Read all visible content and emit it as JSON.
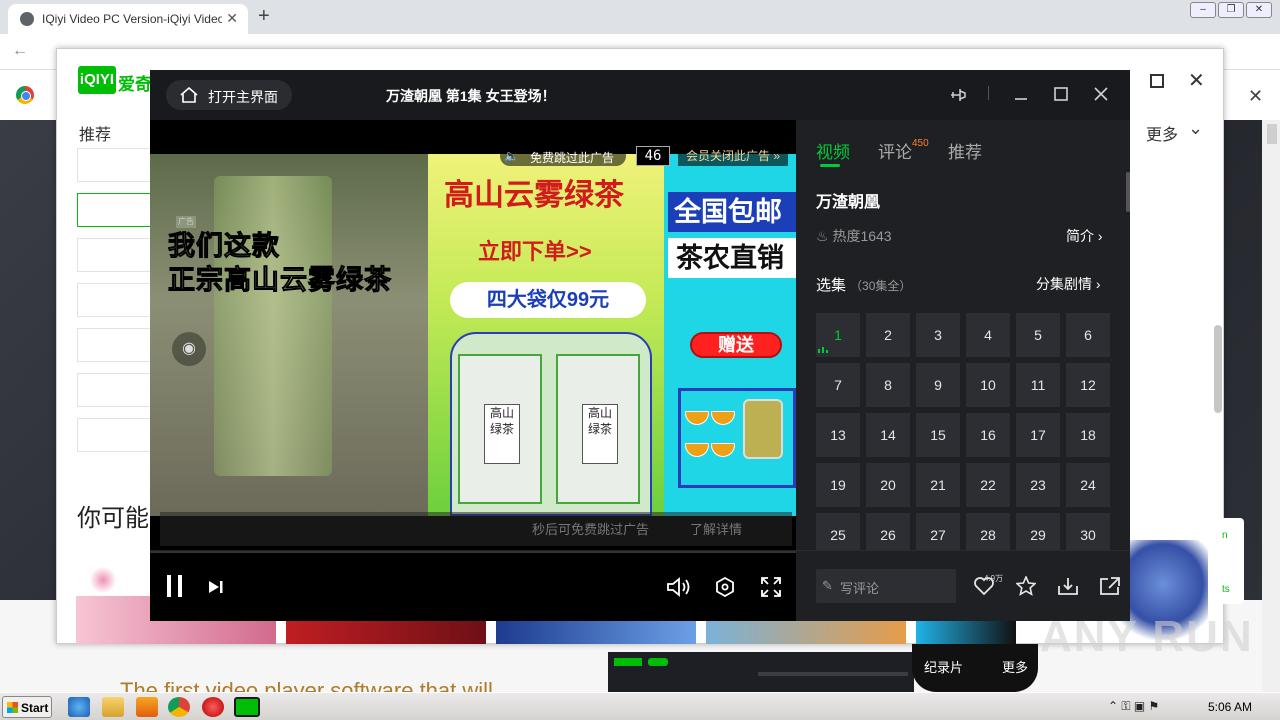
{
  "browser": {
    "tab_title": "IQiyi Video PC Version-iQiyi Video Of",
    "tab_close": "✕",
    "new_tab": "+",
    "window_buttons": [
      "–",
      "❐",
      "✕"
    ],
    "back_icon": "←",
    "infobar_close": "✕"
  },
  "background_site": {
    "logo_badge": "iQIYI",
    "logo_text": "爱奇",
    "recommend": "推荐",
    "maybe_like": "你可能",
    "more": "更多",
    "tagline": "The first video player software that will",
    "categories": [
      "纪录片",
      "更多"
    ],
    "card_text_1": "n",
    "card_text_2": "ts"
  },
  "player": {
    "home_button": "打开主界面",
    "video_title": "万渣朝凰 第1集 女王登场！",
    "ad": {
      "skip_label": "免费跳过此广告",
      "countdown": "46",
      "vip_close": "会员关闭此广告 »",
      "tag": "广告",
      "left_copy_line1": "我们这款",
      "left_copy_line2": "正宗高山云雾绿茶",
      "mid_headline": "高山云雾绿茶",
      "mid_order": "立即下单>>",
      "mid_price": "四大袋仅99元",
      "bag_label": "高山绿茶",
      "right_line1": "全国包邮",
      "right_line2": "茶农直销",
      "gift": "赠送",
      "bottom_hint": "秒后可免费跳过广告",
      "learn_more": "了解详情"
    }
  },
  "sidebar": {
    "tabs": [
      {
        "label": "视频",
        "active": true
      },
      {
        "label": "评论",
        "badge": "450"
      },
      {
        "label": "推荐"
      }
    ],
    "show_title": "万渣朝凰",
    "heat": "热度1643",
    "intro": "简介",
    "episodes_label": "选集",
    "episodes_count": "（30集全）",
    "plot_link": "分集剧情",
    "episodes": [
      "1",
      "2",
      "3",
      "4",
      "5",
      "6",
      "7",
      "8",
      "9",
      "10",
      "11",
      "12",
      "13",
      "14",
      "15",
      "16",
      "17",
      "18",
      "19",
      "20",
      "21",
      "22",
      "23",
      "24",
      "25",
      "26",
      "27",
      "28",
      "29",
      "30"
    ],
    "playing_episode": "1",
    "comment_placeholder": "写评论",
    "like_count": "4.9万"
  },
  "taskbar": {
    "start": "Start",
    "clock": "5:06 AM"
  },
  "colors": {
    "accent_green": "#00cc36",
    "iqiyi_green": "#00be06",
    "sidebar_bg": "#1f2024"
  },
  "watermark": "ANY RUN"
}
